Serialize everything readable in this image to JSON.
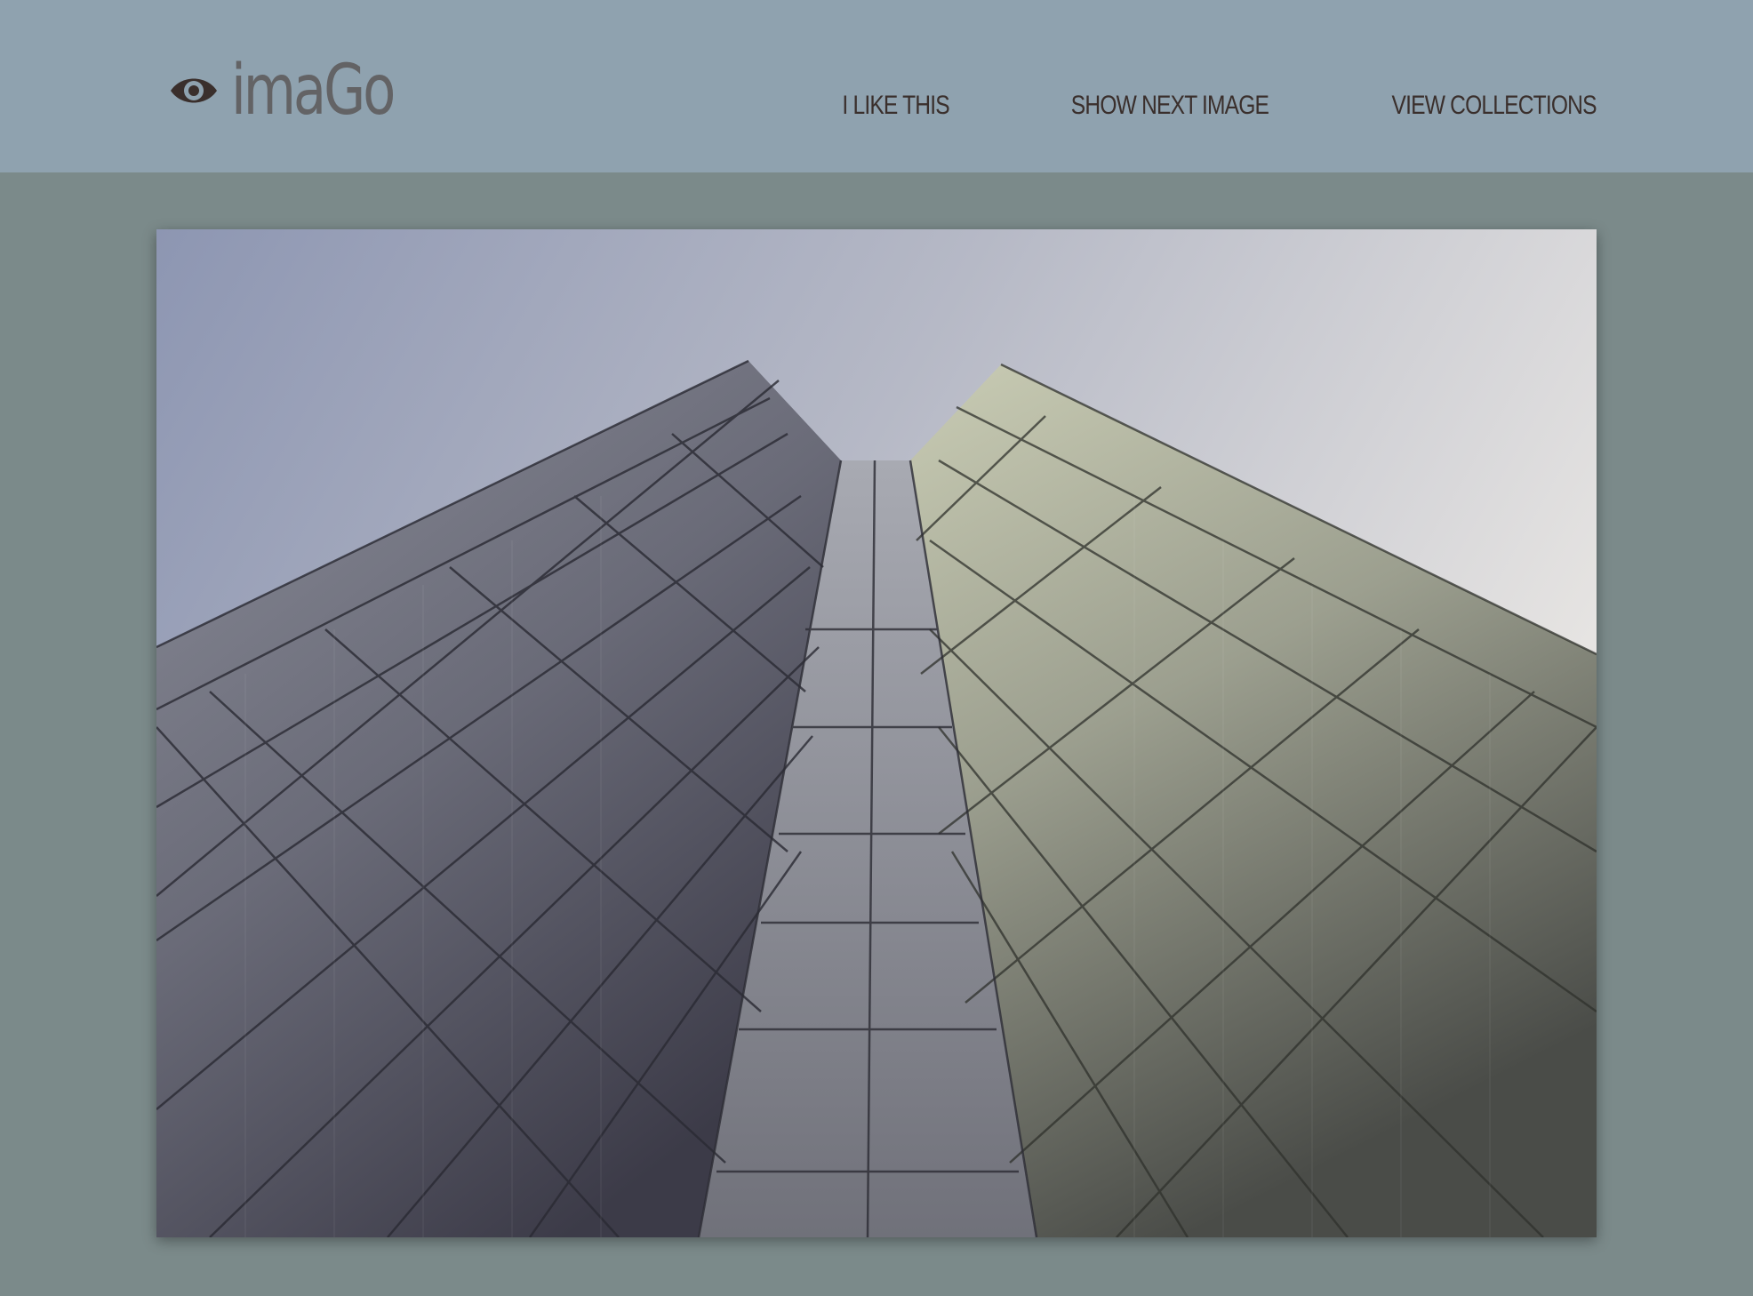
{
  "brand": {
    "name": "imaGo",
    "icon": "eye-icon"
  },
  "nav": {
    "items": [
      {
        "label": "I LIKE THIS"
      },
      {
        "label": "SHOW NEXT IMAGE"
      },
      {
        "label": "VIEW COLLECTIONS"
      }
    ]
  },
  "colors": {
    "header_bg": "#8fa2af",
    "page_bg": "#7b8a8a",
    "nav_text": "#3a2f2c",
    "logo_text": "#636365",
    "logo_icon": "#3a2f2c"
  },
  "image": {
    "subject": "photo"
  }
}
